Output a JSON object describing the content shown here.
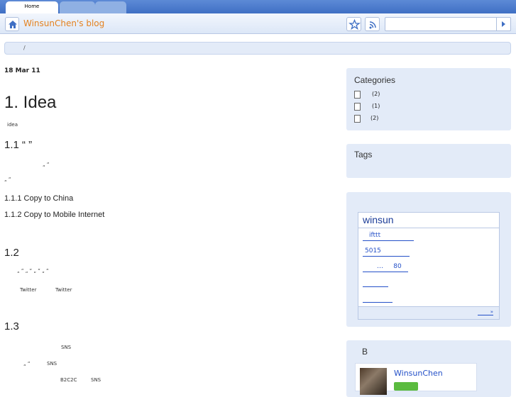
{
  "browser": {
    "tabs": [
      {
        "label": "Home"
      }
    ]
  },
  "toolbar": {
    "blog_title": "WinsunChen's blog",
    "search_value": ""
  },
  "breadcrumb": {
    "text": "/"
  },
  "post": {
    "date": "18 Mar 11",
    "title": "1.  Idea",
    "intro": "idea",
    "s11_title": "1.1 “ ”",
    "s11_quote1": "„ “",
    "s11_quote2": "„ “",
    "s111": "1.1.1 Copy to China",
    "s112": "1.1.2 Copy to Mobile Internet",
    "s12_title": "1.2",
    "s12_line1": "„ “   „ “   „ “   „ “",
    "s12_tw1": "Twitter",
    "s12_tw2": "Twitter",
    "s13_title": "1.3",
    "s13_sns1": "SNS",
    "s13_q": "„ “",
    "s13_sns2": "SNS",
    "s13_b2c": "B2C2C",
    "s13_sns3": "SNS"
  },
  "sidebar": {
    "categories_title": "Categories",
    "categories": [
      {
        "count": "(2)"
      },
      {
        "count": "(1)"
      },
      {
        "count": "(2)"
      }
    ],
    "tags_title": "Tags",
    "widget": {
      "title": "winsun",
      "links": [
        "ifttt",
        "5015",
        "…     80",
        "",
        ""
      ],
      "footer_link": "»"
    },
    "b_title": "B",
    "profile_name": "WinsunChen"
  },
  "colors": {
    "accent": "#e4821f",
    "link": "#2450c8",
    "panel": "#e3ebf8"
  }
}
